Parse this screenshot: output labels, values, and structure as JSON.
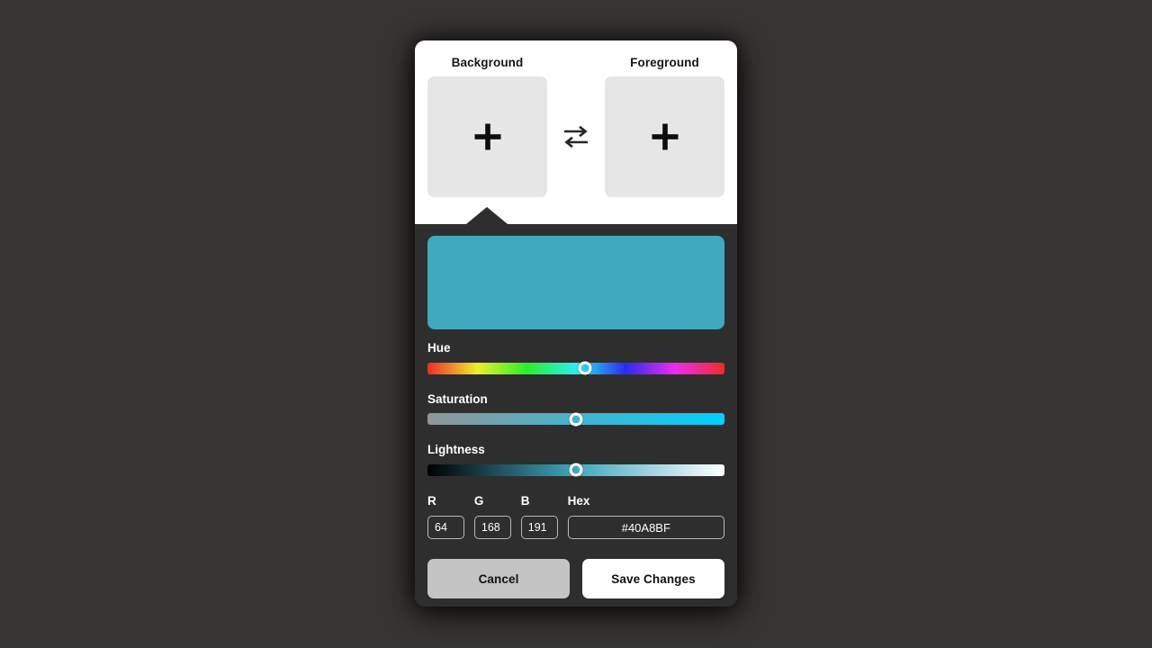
{
  "dialog": {
    "swap_icon": "swap-horizontal-arrows-icon",
    "background_slot": {
      "label": "Background",
      "add_icon": "plus-icon",
      "value": ""
    },
    "foreground_slot": {
      "label": "Foreground",
      "add_icon": "plus-icon",
      "value": ""
    }
  },
  "color": {
    "preview_hex": "#40A8BF",
    "hue_deg": 191,
    "sliders": [
      {
        "name": "hue",
        "label": "Hue",
        "position_pct": 53
      },
      {
        "name": "saturation",
        "label": "Saturation",
        "position_pct": 50
      },
      {
        "name": "lightness",
        "label": "Lightness",
        "position_pct": 50
      }
    ],
    "fields": {
      "r": {
        "label": "R",
        "value": "64"
      },
      "g": {
        "label": "G",
        "value": "168"
      },
      "b": {
        "label": "B",
        "value": "191"
      },
      "hex": {
        "label": "Hex",
        "value": "#40A8BF"
      }
    }
  },
  "buttons": {
    "cancel": "Cancel",
    "save": "Save Changes"
  },
  "theme": {
    "page_bg": "#383533",
    "panel_dark": "#2e2e2e",
    "panel_light": "#ffffff",
    "slot_bg": "#e6e6e6",
    "accent": "#40A8BF",
    "cancel_bg": "#c4c4c4",
    "save_bg": "#ffffff"
  }
}
